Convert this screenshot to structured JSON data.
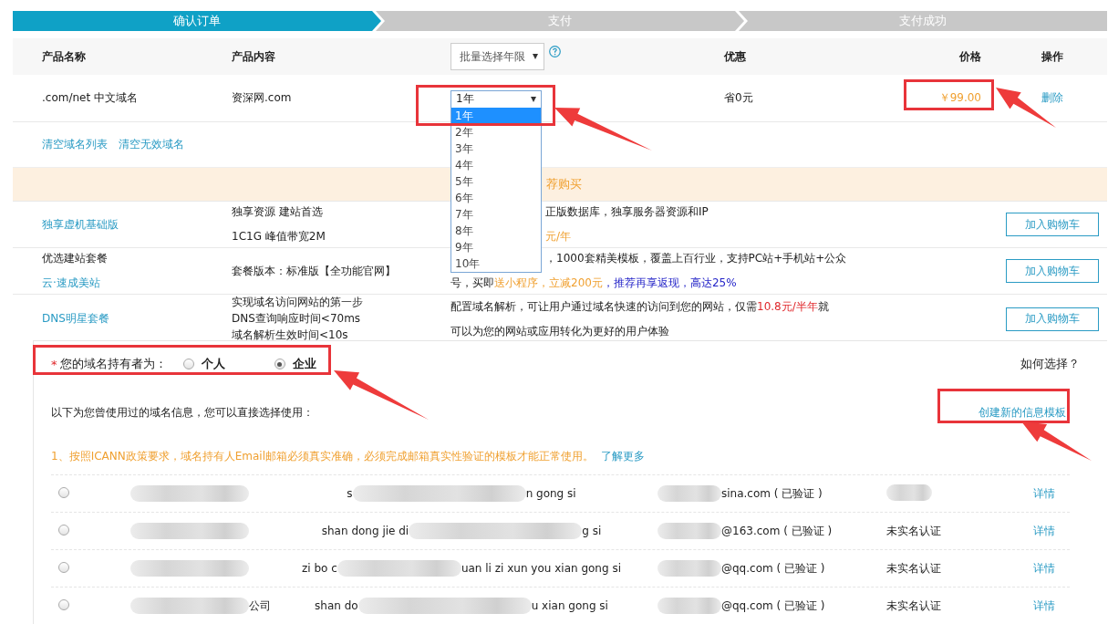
{
  "steps": [
    {
      "label": "确认订单",
      "selected": true
    },
    {
      "label": "支付",
      "selected": false
    },
    {
      "label": "支付成功",
      "selected": false
    }
  ],
  "order_table": {
    "columns": {
      "name": "产品名称",
      "content": "产品内容",
      "bulk_select": "批量选择年限",
      "discount": "优惠",
      "price": "价格",
      "action": "操作"
    },
    "rows": [
      {
        "name": ".com/net 中文域名",
        "content": "资深网.com",
        "years": "1年",
        "discount": "省0元",
        "price": "￥99.00",
        "action": "删除"
      }
    ],
    "year_options": [
      {
        "label": "1年",
        "selected": true
      },
      {
        "label": "2年",
        "selected": false
      },
      {
        "label": "3年",
        "selected": false
      },
      {
        "label": "4年",
        "selected": false
      },
      {
        "label": "5年",
        "selected": false
      },
      {
        "label": "6年",
        "selected": false
      },
      {
        "label": "7年",
        "selected": false
      },
      {
        "label": "8年",
        "selected": false
      },
      {
        "label": "9年",
        "selected": false
      },
      {
        "label": "10年",
        "selected": false
      }
    ],
    "links": [
      "清空域名列表",
      "清空无效域名"
    ]
  },
  "recommend": {
    "title": "荐购买",
    "rows": [
      {
        "names": [
          {
            "kind": "link",
            "text": "独享虚机基础版"
          }
        ],
        "content": [
          "独享资源 建站首选",
          "1C1G 峰值带宽2M"
        ],
        "desc": [
          [
            {
              "kind": "plain",
              "text": "正版数据库，独享服务器资源和IP"
            }
          ],
          [
            {
              "kind": "promo",
              "text": "元/年"
            }
          ]
        ],
        "button": "加入购物车"
      },
      {
        "names": [
          {
            "kind": "plain",
            "text": "优选建站套餐"
          },
          {
            "kind": "link",
            "text": "云·速成美站"
          }
        ],
        "content": [
          "套餐版本：标准版【全功能官网】"
        ],
        "desc": [
          [
            {
              "kind": "plain",
              "text": "，1000套精美模板，覆盖上百行业，支持PC站+手机站+公众"
            }
          ],
          [
            {
              "kind": "plain",
              "text": "号，买即"
            },
            {
              "kind": "promo",
              "text": "送小程序，立减200元"
            },
            {
              "kind": "rebate",
              "text": "，推荐再享返现，高达25%"
            }
          ]
        ],
        "button": "加入购物车"
      },
      {
        "names": [
          {
            "kind": "link",
            "text": "DNS明星套餐"
          }
        ],
        "content": [
          "实现域名访问网站的第一步",
          "DNS查询响应时间<70ms",
          "域名解析生效时间<10s"
        ],
        "desc": [
          [
            {
              "kind": "plain",
              "text": "配置域名解析，可让用户通过域名快速的访问到您的网站，仅需"
            },
            {
              "kind": "price",
              "text": "10.8元/半年"
            },
            {
              "kind": "plain",
              "text": "就"
            }
          ],
          [
            {
              "kind": "plain",
              "text": "可以为您的网站或应用转化为更好的用户体验"
            }
          ]
        ],
        "button": "加入购物车"
      }
    ]
  },
  "owner": {
    "required_mark": "*",
    "label": "您的域名持有者为：",
    "options": [
      {
        "label": "个人",
        "selected": false
      },
      {
        "label": "企业",
        "selected": true
      }
    ],
    "help": "如何选择？"
  },
  "templates": {
    "intro": "以下为您曾使用过的域名信息，您可以直接选择使用：",
    "create_link": "创建新的信息模板",
    "notice": "1、按照ICANN政策要求，域名持有人Email邮箱必须真实准确，必须完成邮箱真实性验证的模板才能正常使用。",
    "learn_more": "了解更多",
    "rows": [
      {
        "selected": false,
        "name_tail": "",
        "pinyin_head": "s",
        "pinyin_tail": "n gong si",
        "email_tail": "sina.com ( 已验证 )",
        "status": "",
        "detail": "详情"
      },
      {
        "selected": false,
        "name_tail": "",
        "pinyin_head": "shan dong jie di",
        "pinyin_tail": "g si",
        "email_tail": "@163.com ( 已验证 )",
        "status": "未实名认证",
        "detail": "详情"
      },
      {
        "selected": false,
        "name_tail": "",
        "pinyin_head": "zi bo c",
        "pinyin_tail": "uan li zi xun you xian gong si",
        "email_tail": "@qq.com ( 已验证 )",
        "status": "未实名认证",
        "detail": "详情"
      },
      {
        "selected": false,
        "name_tail": "公司",
        "pinyin_head": "shan do",
        "pinyin_tail": "u xian gong si",
        "email_tail": "@qq.com ( 已验证 )",
        "status": "未实名认证",
        "detail": "详情"
      }
    ]
  }
}
